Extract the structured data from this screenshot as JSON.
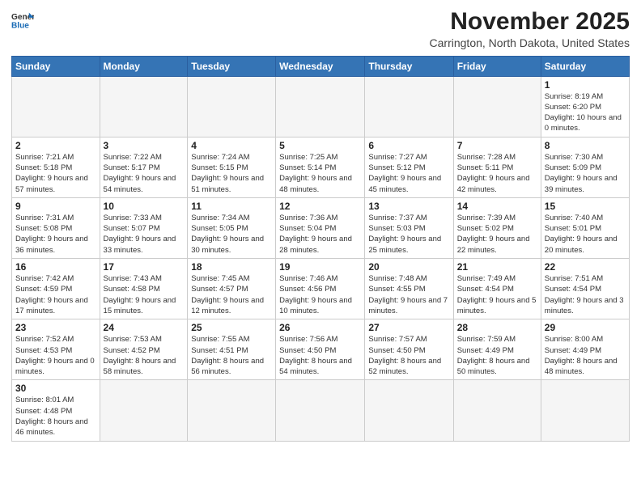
{
  "logo": {
    "line1": "General",
    "line2": "Blue"
  },
  "title": "November 2025",
  "subtitle": "Carrington, North Dakota, United States",
  "header_days": [
    "Sunday",
    "Monday",
    "Tuesday",
    "Wednesday",
    "Thursday",
    "Friday",
    "Saturday"
  ],
  "weeks": [
    [
      {
        "day": "",
        "info": ""
      },
      {
        "day": "",
        "info": ""
      },
      {
        "day": "",
        "info": ""
      },
      {
        "day": "",
        "info": ""
      },
      {
        "day": "",
        "info": ""
      },
      {
        "day": "",
        "info": ""
      },
      {
        "day": "1",
        "info": "Sunrise: 8:19 AM\nSunset: 6:20 PM\nDaylight: 10 hours and 0 minutes."
      }
    ],
    [
      {
        "day": "2",
        "info": "Sunrise: 7:21 AM\nSunset: 5:18 PM\nDaylight: 9 hours and 57 minutes."
      },
      {
        "day": "3",
        "info": "Sunrise: 7:22 AM\nSunset: 5:17 PM\nDaylight: 9 hours and 54 minutes."
      },
      {
        "day": "4",
        "info": "Sunrise: 7:24 AM\nSunset: 5:15 PM\nDaylight: 9 hours and 51 minutes."
      },
      {
        "day": "5",
        "info": "Sunrise: 7:25 AM\nSunset: 5:14 PM\nDaylight: 9 hours and 48 minutes."
      },
      {
        "day": "6",
        "info": "Sunrise: 7:27 AM\nSunset: 5:12 PM\nDaylight: 9 hours and 45 minutes."
      },
      {
        "day": "7",
        "info": "Sunrise: 7:28 AM\nSunset: 5:11 PM\nDaylight: 9 hours and 42 minutes."
      },
      {
        "day": "8",
        "info": "Sunrise: 7:30 AM\nSunset: 5:09 PM\nDaylight: 9 hours and 39 minutes."
      }
    ],
    [
      {
        "day": "9",
        "info": "Sunrise: 7:31 AM\nSunset: 5:08 PM\nDaylight: 9 hours and 36 minutes."
      },
      {
        "day": "10",
        "info": "Sunrise: 7:33 AM\nSunset: 5:07 PM\nDaylight: 9 hours and 33 minutes."
      },
      {
        "day": "11",
        "info": "Sunrise: 7:34 AM\nSunset: 5:05 PM\nDaylight: 9 hours and 30 minutes."
      },
      {
        "day": "12",
        "info": "Sunrise: 7:36 AM\nSunset: 5:04 PM\nDaylight: 9 hours and 28 minutes."
      },
      {
        "day": "13",
        "info": "Sunrise: 7:37 AM\nSunset: 5:03 PM\nDaylight: 9 hours and 25 minutes."
      },
      {
        "day": "14",
        "info": "Sunrise: 7:39 AM\nSunset: 5:02 PM\nDaylight: 9 hours and 22 minutes."
      },
      {
        "day": "15",
        "info": "Sunrise: 7:40 AM\nSunset: 5:01 PM\nDaylight: 9 hours and 20 minutes."
      }
    ],
    [
      {
        "day": "16",
        "info": "Sunrise: 7:42 AM\nSunset: 4:59 PM\nDaylight: 9 hours and 17 minutes."
      },
      {
        "day": "17",
        "info": "Sunrise: 7:43 AM\nSunset: 4:58 PM\nDaylight: 9 hours and 15 minutes."
      },
      {
        "day": "18",
        "info": "Sunrise: 7:45 AM\nSunset: 4:57 PM\nDaylight: 9 hours and 12 minutes."
      },
      {
        "day": "19",
        "info": "Sunrise: 7:46 AM\nSunset: 4:56 PM\nDaylight: 9 hours and 10 minutes."
      },
      {
        "day": "20",
        "info": "Sunrise: 7:48 AM\nSunset: 4:55 PM\nDaylight: 9 hours and 7 minutes."
      },
      {
        "day": "21",
        "info": "Sunrise: 7:49 AM\nSunset: 4:54 PM\nDaylight: 9 hours and 5 minutes."
      },
      {
        "day": "22",
        "info": "Sunrise: 7:51 AM\nSunset: 4:54 PM\nDaylight: 9 hours and 3 minutes."
      }
    ],
    [
      {
        "day": "23",
        "info": "Sunrise: 7:52 AM\nSunset: 4:53 PM\nDaylight: 9 hours and 0 minutes."
      },
      {
        "day": "24",
        "info": "Sunrise: 7:53 AM\nSunset: 4:52 PM\nDaylight: 8 hours and 58 minutes."
      },
      {
        "day": "25",
        "info": "Sunrise: 7:55 AM\nSunset: 4:51 PM\nDaylight: 8 hours and 56 minutes."
      },
      {
        "day": "26",
        "info": "Sunrise: 7:56 AM\nSunset: 4:50 PM\nDaylight: 8 hours and 54 minutes."
      },
      {
        "day": "27",
        "info": "Sunrise: 7:57 AM\nSunset: 4:50 PM\nDaylight: 8 hours and 52 minutes."
      },
      {
        "day": "28",
        "info": "Sunrise: 7:59 AM\nSunset: 4:49 PM\nDaylight: 8 hours and 50 minutes."
      },
      {
        "day": "29",
        "info": "Sunrise: 8:00 AM\nSunset: 4:49 PM\nDaylight: 8 hours and 48 minutes."
      }
    ],
    [
      {
        "day": "30",
        "info": "Sunrise: 8:01 AM\nSunset: 4:48 PM\nDaylight: 8 hours and 46 minutes."
      },
      {
        "day": "",
        "info": ""
      },
      {
        "day": "",
        "info": ""
      },
      {
        "day": "",
        "info": ""
      },
      {
        "day": "",
        "info": ""
      },
      {
        "day": "",
        "info": ""
      },
      {
        "day": "",
        "info": ""
      }
    ]
  ]
}
